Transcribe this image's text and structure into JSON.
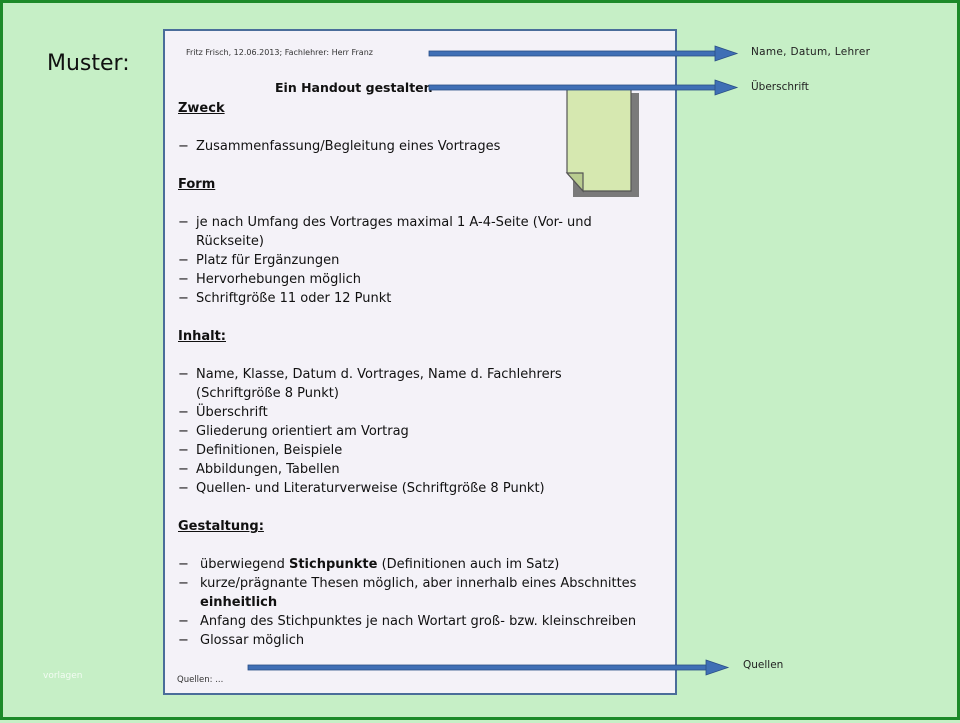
{
  "title": "Muster:",
  "watermark": "vorlagen",
  "handout": {
    "meta": "Fritz Frisch, 12.06.2013; Fachlehrer: Herr Franz",
    "heading": "Ein Handout gestalten",
    "sections": {
      "zweck": {
        "title": "Zweck",
        "items": [
          "Zusammenfassung/Begleitung eines Vortrages"
        ]
      },
      "form": {
        "title": "Form",
        "items": [
          "je nach Umfang des Vortrages maximal 1 A-4-Seite (Vor- und Rückseite)",
          "Platz für Ergänzungen",
          "Hervorhebungen möglich",
          "Schriftgröße 11 oder 12 Punkt"
        ]
      },
      "inhalt": {
        "title": "Inhalt:",
        "items": [
          "Name, Klasse, Datum d. Vortrages, Name d. Fachlehrers (Schriftgröße 8 Punkt)",
          "Überschrift",
          "Gliederung orientiert am Vortrag",
          "Definitionen, Beispiele",
          "Abbildungen, Tabellen",
          "Quellen- und Literaturverweise (Schriftgröße 8 Punkt)"
        ]
      },
      "gestaltung": {
        "title": "Gestaltung:",
        "items": [
          {
            "pre": "überwiegend ",
            "bold": "Stichpunkte",
            "post": " (Definitionen auch im Satz)"
          },
          {
            "pre": "kurze/prägnante Thesen möglich, aber innerhalb eines Abschnittes ",
            "bold": "einheitlich",
            "post": ""
          },
          {
            "pre": "Anfang des Stichpunktes je nach Wortart groß- bzw. kleinschreiben",
            "bold": "",
            "post": ""
          },
          {
            "pre": "Glossar möglich",
            "bold": "",
            "post": ""
          }
        ]
      }
    },
    "dash": "−",
    "sources": "Quellen: ..."
  },
  "annotations": {
    "name": "Name,  Datum,  Lehrer",
    "heading": "Überschrift",
    "sources": "Quellen"
  },
  "colors": {
    "background": "#c6efc6",
    "frame": "#1d8a2a",
    "paper": "#f4f2f8",
    "paper_border": "#4a6d9a",
    "arrow": "#3f6fb5",
    "note": "#d6e8b0"
  }
}
